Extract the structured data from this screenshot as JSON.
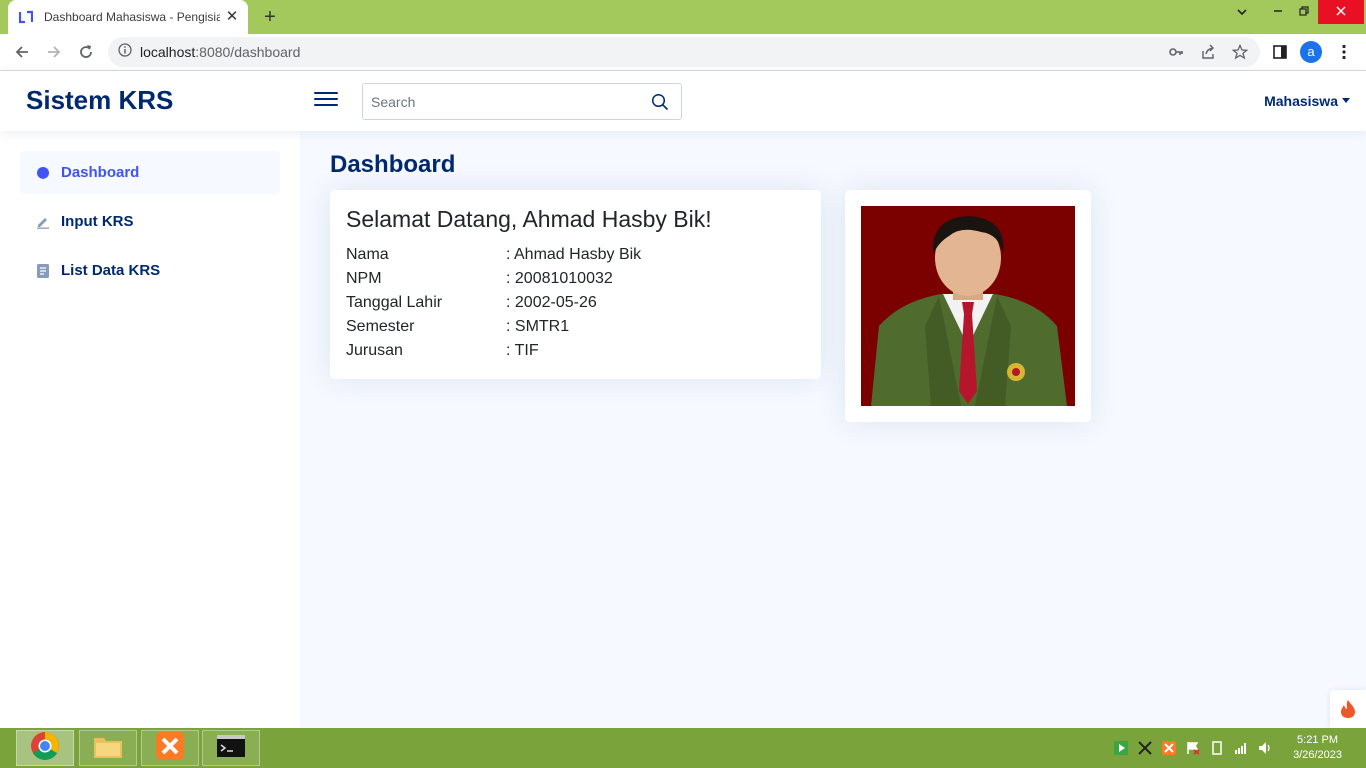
{
  "browser": {
    "tab_title": "Dashboard Mahasiswa - Pengisian KRS",
    "close_tab": "✕",
    "new_tab": "+",
    "url_host": "localhost",
    "url_path": ":8080/dashboard",
    "profile_initial": "a"
  },
  "header": {
    "brand": "Sistem KRS",
    "search_placeholder": "Search",
    "user_menu": "Mahasiswa"
  },
  "sidebar": {
    "items": [
      {
        "label": "Dashboard",
        "icon": "dashboard-icon",
        "active": true
      },
      {
        "label": "Input KRS",
        "icon": "pencil-icon",
        "active": false
      },
      {
        "label": "List Data KRS",
        "icon": "document-icon",
        "active": false
      }
    ]
  },
  "main": {
    "page_title": "Dashboard",
    "welcome": "Selamat Datang, Ahmad Hasby Bik!",
    "fields": [
      {
        "label": "Nama",
        "value": ": Ahmad Hasby Bik"
      },
      {
        "label": "NPM",
        "value": ": 20081010032"
      },
      {
        "label": "Tanggal Lahir",
        "value": ": 2002-05-26"
      },
      {
        "label": "Semester",
        "value": ": SMTR1"
      },
      {
        "label": "Jurusan",
        "value": ": TIF"
      }
    ]
  },
  "taskbar": {
    "time": "5:21 PM",
    "date": "3/26/2023"
  },
  "colors": {
    "brand": "#012970",
    "accent": "#4154f1",
    "main_bg": "#f6f9ff",
    "taskbar": "#7aa33c",
    "photo_bg": "#7b0000"
  }
}
